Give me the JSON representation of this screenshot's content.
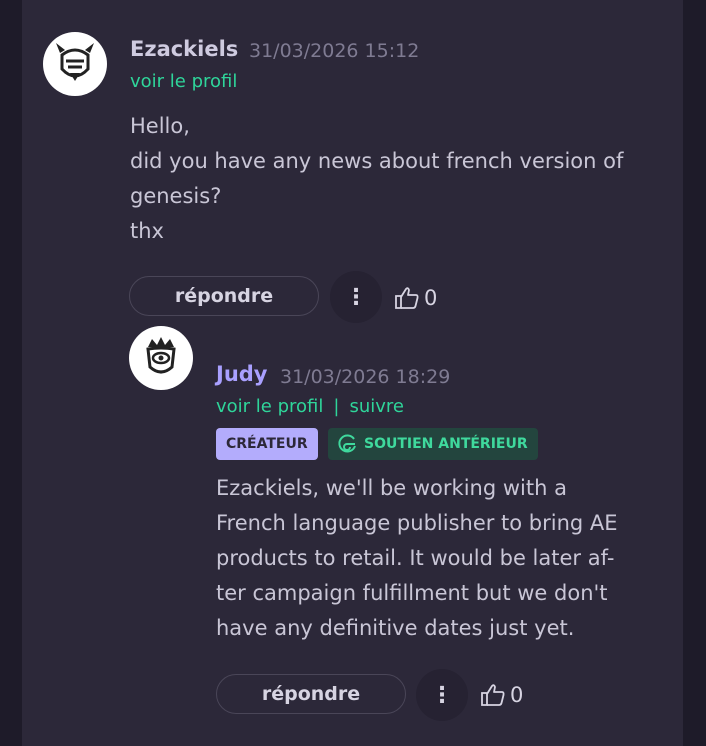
{
  "comments": [
    {
      "author": "Ezackiels",
      "author_color": "#cfcbe0",
      "date": "31/03/2026 15:12",
      "links": [
        "voir le profil"
      ],
      "body": "Hello,\ndid you have any news about french version of\ngenesis?\nthx",
      "reply_label": "répondre",
      "menu_glyph": "⋮",
      "likes": "0"
    },
    {
      "author": "Judy",
      "author_color": "#a9a0ff",
      "date": "31/03/2026 18:29",
      "links": [
        "voir le profil",
        "|",
        "suivre"
      ],
      "badges": [
        "CRÉATEUR",
        "SOUTIEN ANTÉRIEUR"
      ],
      "body": "Ezackiels, we'll be working with a\nFrench language publisher to bring AE\nproducts to retail. It would be later af-\nter campaign fulfillment but we don't\nhave any definitive dates just yet.",
      "reply_label": "répondre",
      "menu_glyph": "⋮",
      "likes": "0"
    }
  ],
  "colors": {
    "accent_green": "#2fd59a",
    "creator_badge_bg": "#b3acfc",
    "creator_badge_text": "#2c2839",
    "backer_badge_bg": "#23453e",
    "backer_badge_text": "#3fd99d"
  },
  "icons": [
    "avatar-viking-helmet",
    "avatar-crowned-eye",
    "kebab-menu-icon",
    "thumbs-up-icon",
    "refresh-g-icon"
  ]
}
